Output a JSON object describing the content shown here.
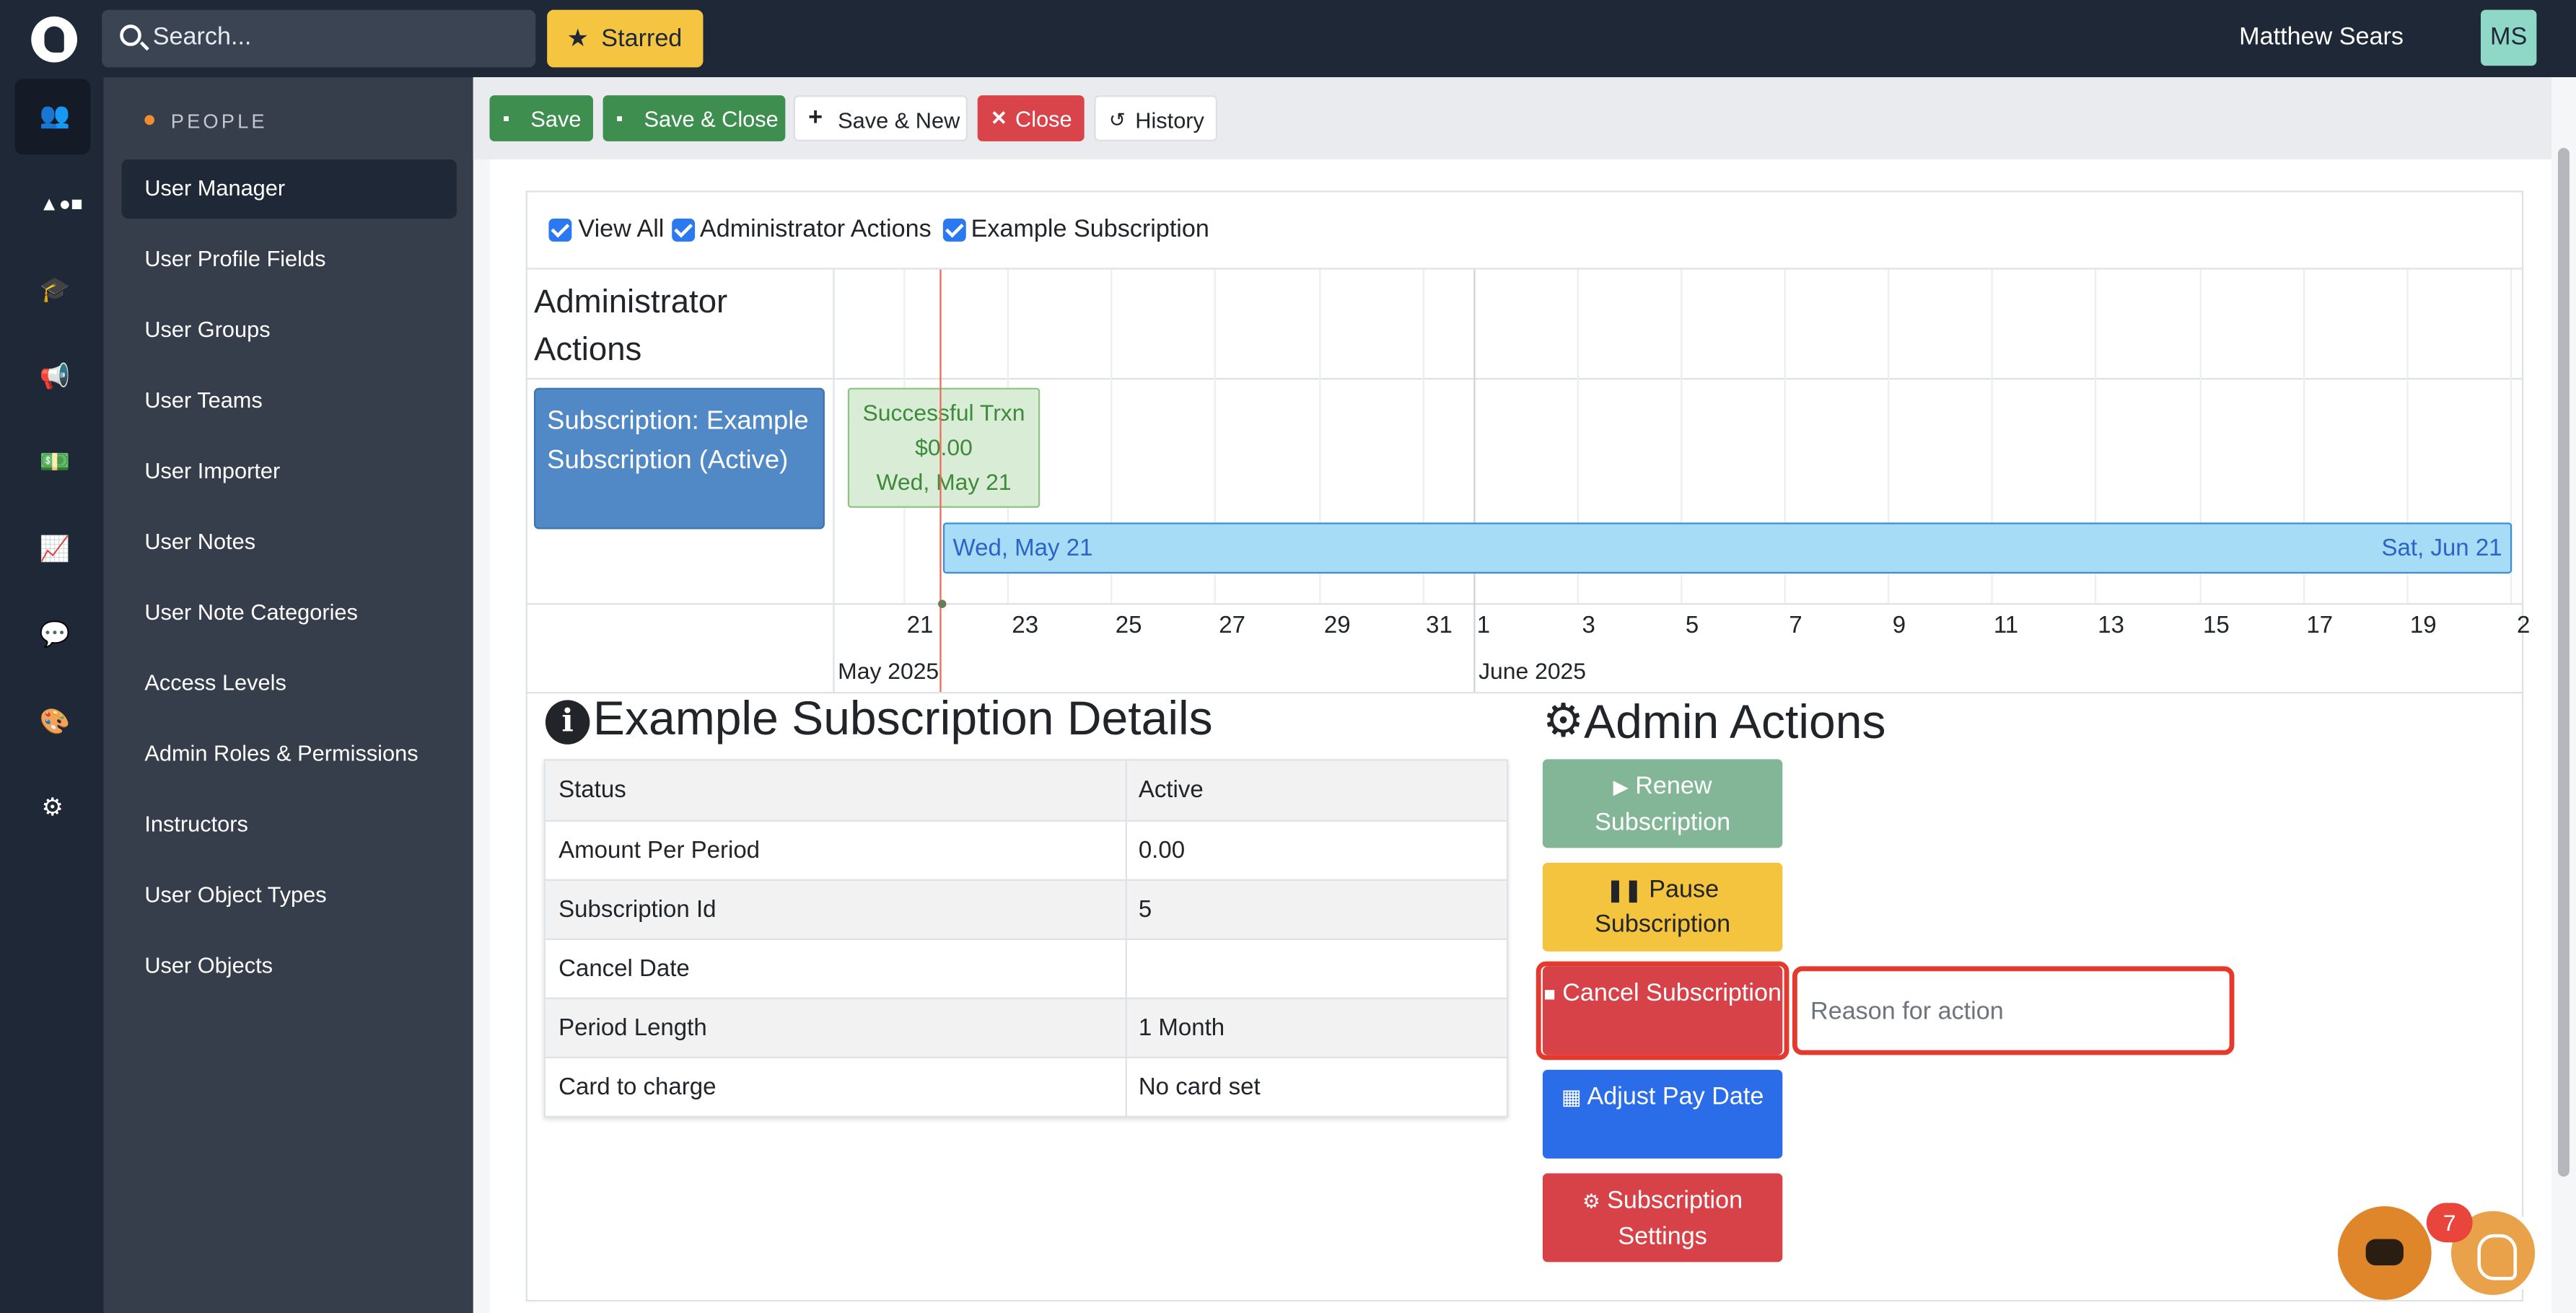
{
  "topbar": {
    "search_placeholder": "Search...",
    "starred_label": "Starred",
    "user_name": "Matthew Sears",
    "user_initials": "MS"
  },
  "rail": {
    "icons": [
      "users-icon",
      "shapes-icon",
      "graduation-cap-icon",
      "megaphone-icon",
      "money-icon",
      "chart-icon",
      "chat-icon",
      "palette-icon",
      "gear-icon"
    ],
    "active": "users-icon"
  },
  "sidebar": {
    "section": "PEOPLE",
    "items": [
      {
        "label": "User Manager"
      },
      {
        "label": "User Profile Fields"
      },
      {
        "label": "User Groups"
      },
      {
        "label": "User Teams"
      },
      {
        "label": "User Importer"
      },
      {
        "label": "User Notes"
      },
      {
        "label": "User Note Categories"
      },
      {
        "label": "Access Levels"
      },
      {
        "label": "Admin Roles & Permissions"
      },
      {
        "label": "Instructors"
      },
      {
        "label": "User Object Types"
      },
      {
        "label": "User Objects"
      }
    ],
    "active_item": "User Manager"
  },
  "toolbar": {
    "save": "Save",
    "save_close": "Save & Close",
    "save_new": "Save & New",
    "close": "Close",
    "history": "History"
  },
  "filters": {
    "view_all": "View All",
    "admin_actions": "Administrator Actions",
    "example_subscription": "Example Subscription"
  },
  "timeline": {
    "group_label": "Administrator Actions",
    "subscription_item": "Subscription: Example Subscription (Active)",
    "transaction": {
      "title": "Successful Trxn",
      "amount": "$0.00",
      "date": "Wed, May 21"
    },
    "range": {
      "start": "Wed, May 21",
      "end": "Sat, Jun 21"
    },
    "ticks": [
      "21",
      "23",
      "25",
      "27",
      "29",
      "31",
      "1",
      "3",
      "5",
      "7",
      "9",
      "11",
      "13",
      "15",
      "17",
      "19",
      "2"
    ],
    "months": [
      "May 2025",
      "June 2025"
    ]
  },
  "details": {
    "title": "Example Subscription Details",
    "rows": [
      {
        "key": "Status",
        "value": "Active"
      },
      {
        "key": "Amount Per Period",
        "value": "0.00"
      },
      {
        "key": "Subscription Id",
        "value": "5"
      },
      {
        "key": "Cancel Date",
        "value": ""
      },
      {
        "key": "Period Length",
        "value": "1 Month"
      },
      {
        "key": "Card to charge",
        "value": "No card set"
      }
    ]
  },
  "admin": {
    "title": "Admin Actions",
    "renew": "Renew Subscription",
    "pause": "Pause Subscription",
    "cancel": "Cancel Subscription",
    "adjust": "Adjust Pay Date",
    "settings": "Subscription Settings",
    "reason_placeholder": "Reason for action"
  },
  "chat": {
    "badge": "7"
  },
  "colors": {
    "topbar": "#1f2836",
    "sidebar": "#363e4b",
    "accent_orange": "#f28b32",
    "save_green": "#3e8e4f",
    "danger_red": "#d9434a",
    "primary_blue": "#2b6de8",
    "starred_yellow": "#f5c542"
  }
}
